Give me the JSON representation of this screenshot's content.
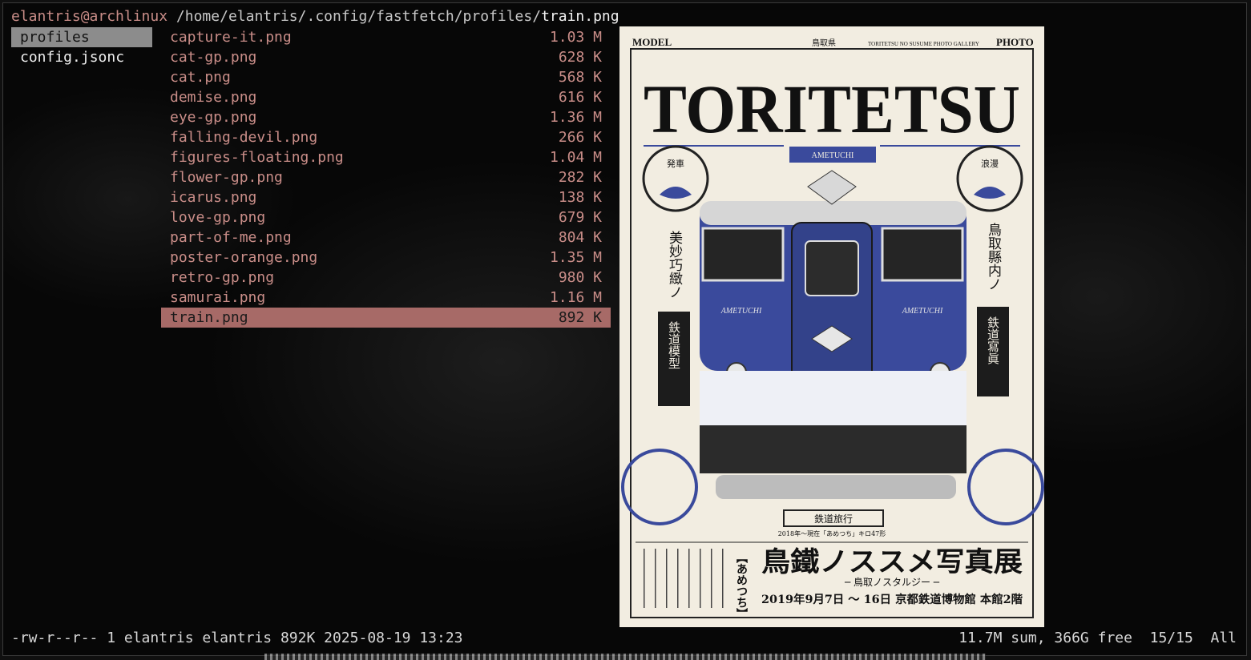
{
  "header": {
    "user_host": "elantris@archlinux",
    "dir": "/home/elantris/.config/fastfetch/profiles/",
    "file": "train.png"
  },
  "parent_items": [
    {
      "label": "profiles",
      "selected": true
    },
    {
      "label": "config.jsonc",
      "selected": false
    }
  ],
  "files": [
    {
      "name": "capture-it.png",
      "size": "1.03 M"
    },
    {
      "name": "cat-gp.png",
      "size": "628 K"
    },
    {
      "name": "cat.png",
      "size": "568 K"
    },
    {
      "name": "demise.png",
      "size": "616 K"
    },
    {
      "name": "eye-gp.png",
      "size": "1.36 M"
    },
    {
      "name": "falling-devil.png",
      "size": "266 K"
    },
    {
      "name": "figures-floating.png",
      "size": "1.04 M"
    },
    {
      "name": "flower-gp.png",
      "size": "282 K"
    },
    {
      "name": "icarus.png",
      "size": "138 K"
    },
    {
      "name": "love-gp.png",
      "size": "679 K"
    },
    {
      "name": "part-of-me.png",
      "size": "804 K"
    },
    {
      "name": "poster-orange.png",
      "size": "1.35 M"
    },
    {
      "name": "retro-gp.png",
      "size": "980 K"
    },
    {
      "name": "samurai.png",
      "size": "1.16 M"
    },
    {
      "name": "train.png",
      "size": "892 K",
      "selected": true
    }
  ],
  "preview": {
    "top_left": "MODEL",
    "top_right": "PHOTO",
    "pref": "鳥取県",
    "gallery": "TORITETSU NO SUSUME PHOTO GALLERY",
    "title": "TORITETSU",
    "ribbon": "AMETUCHI",
    "emblem_left": "発車",
    "emblem_right": "浪漫",
    "vert_left": "美妙巧緻ノ",
    "vert_right": "鳥取縣内ノ",
    "box_left": "鉄道模型",
    "box_right": "鉄道寫眞",
    "train_name": "AMETUCHI",
    "banner": "鉄道旅行",
    "small_line": "2018年〜現在「あめつち」キロ47形",
    "bracket": "【あめつち】",
    "big_jp": "鳥鐵ノススメ写真展",
    "sub_jp": "─ 鳥取ノスタルジー ─",
    "date_line": "2019年9月7日 ～ 16日 京都鉄道博物館 本館2階"
  },
  "status": {
    "left": "-rw-r--r-- 1 elantris elantris 892K 2025-08-19 13:23",
    "right": "11.7M sum, 366G free  15/15  All"
  },
  "colors": {
    "accent_user": "#c98d88",
    "selection_bg": "#a76a67",
    "train_blue": "#3a4a9c"
  }
}
